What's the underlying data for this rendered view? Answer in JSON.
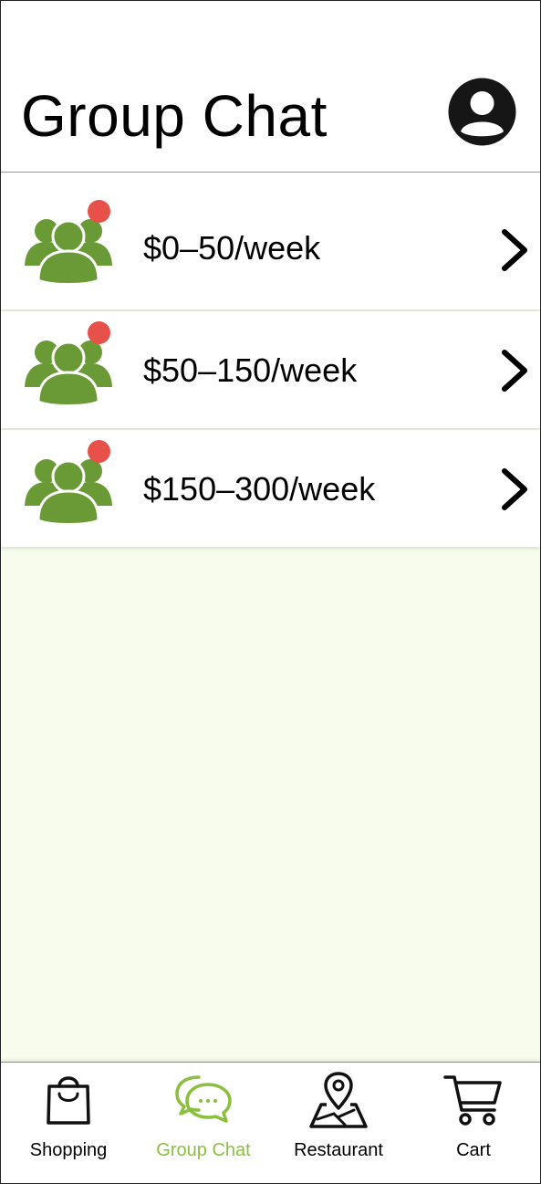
{
  "header": {
    "title": "Group Chat",
    "avatar_icon": "user-circle-icon"
  },
  "colors": {
    "accent": "#8bbf3e",
    "group_icon": "#6a9a36",
    "badge": "#e8504a",
    "content_bg": "#f8fcec"
  },
  "chats": [
    {
      "label": "$0–50/week",
      "icon": "group-icon",
      "unread": true
    },
    {
      "label": "$50–150/week",
      "icon": "group-icon",
      "unread": true
    },
    {
      "label": "$150–300/week",
      "icon": "group-icon",
      "unread": true
    }
  ],
  "tabbar": {
    "tabs": [
      {
        "label": "Shopping",
        "icon": "shopping-bag-icon",
        "active": false
      },
      {
        "label": "Group Chat",
        "icon": "chat-bubbles-icon",
        "active": true
      },
      {
        "label": "Restaurant",
        "icon": "map-pin-icon",
        "active": false
      },
      {
        "label": "Cart",
        "icon": "cart-icon",
        "active": false
      }
    ]
  }
}
